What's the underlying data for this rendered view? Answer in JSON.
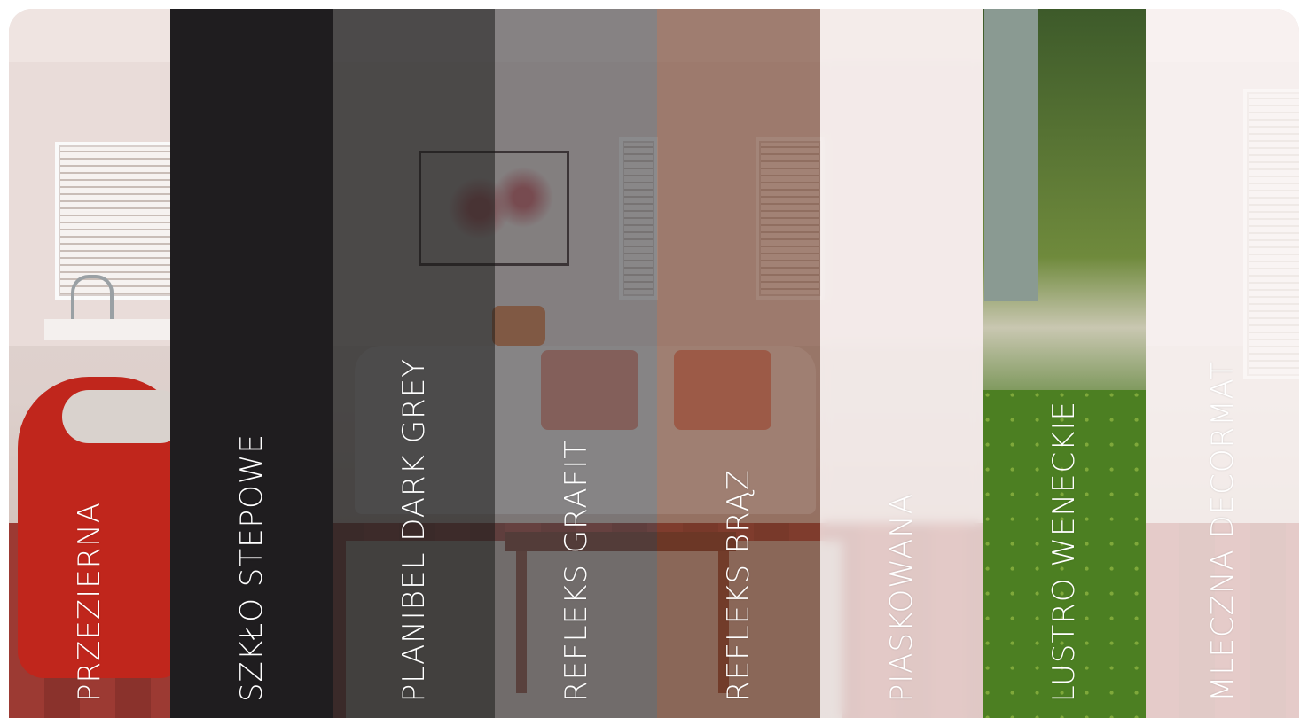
{
  "glass_types": [
    {
      "label": "PRZEZIERNA"
    },
    {
      "label": "SZKŁO STEPOWE"
    },
    {
      "label": "PLANIBEL DARK GREY"
    },
    {
      "label": "REFLEKS GRAFIT"
    },
    {
      "label": "REFLEKS BRĄZ"
    },
    {
      "label": "PIASKOWANA"
    },
    {
      "label": "LUSTRO WENECKIE"
    },
    {
      "label": "MLECZNA DECORMAT"
    }
  ],
  "colors": {
    "szklo_stepowe": "#1f1d1f",
    "planibel_dark_grey": "#282828",
    "refleks_grafit": "#464648",
    "refleks_braz": "#6e3e2a",
    "label_text": "#ffffff"
  }
}
